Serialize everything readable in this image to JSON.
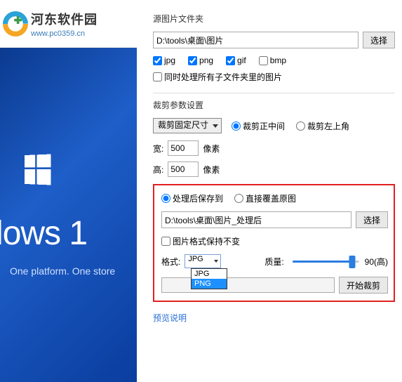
{
  "watermark": {
    "title": "河东软件园",
    "url": "www.pc0359.cn"
  },
  "leftPane": {
    "logoText": "dows 1",
    "subtitle": "One platform. One store"
  },
  "source": {
    "title": "源图片文件夹",
    "path": "D:\\tools\\桌面\\图片",
    "selectBtn": "选择",
    "formats": {
      "jpg": "jpg",
      "png": "png",
      "gif": "gif",
      "bmp": "bmp"
    },
    "checked": {
      "jpg": true,
      "png": true,
      "gif": true,
      "bmp": false
    },
    "subfolderLabel": "同时处理所有子文件夹里的图片",
    "subfolderChecked": false
  },
  "crop": {
    "title": "裁剪参数设置",
    "modeSelect": "裁剪固定尺寸",
    "radios": {
      "center": "裁剪正中间",
      "topleft": "裁剪左上角"
    },
    "radioSelected": "center",
    "widthLabel": "宽:",
    "widthValue": "500",
    "widthUnit": "像素",
    "heightLabel": "高:",
    "heightValue": "500",
    "heightUnit": "像素"
  },
  "output": {
    "saveRadios": {
      "saveTo": "处理后保存到",
      "overwrite": "直接覆盖原图"
    },
    "saveSelected": "saveTo",
    "path": "D:\\tools\\桌面\\图片_处理后",
    "selectBtn": "选择",
    "keepFormatLabel": "图片格式保持不变",
    "keepFormatChecked": false,
    "formatLabel": "格式:",
    "formatValue": "JPG",
    "formatOptions": [
      "JPG",
      "PNG"
    ],
    "qualityLabel": "质量:",
    "qualityValue": "90(高)",
    "startBtn": "开始裁剪"
  },
  "preview": {
    "title": "预览说明"
  }
}
